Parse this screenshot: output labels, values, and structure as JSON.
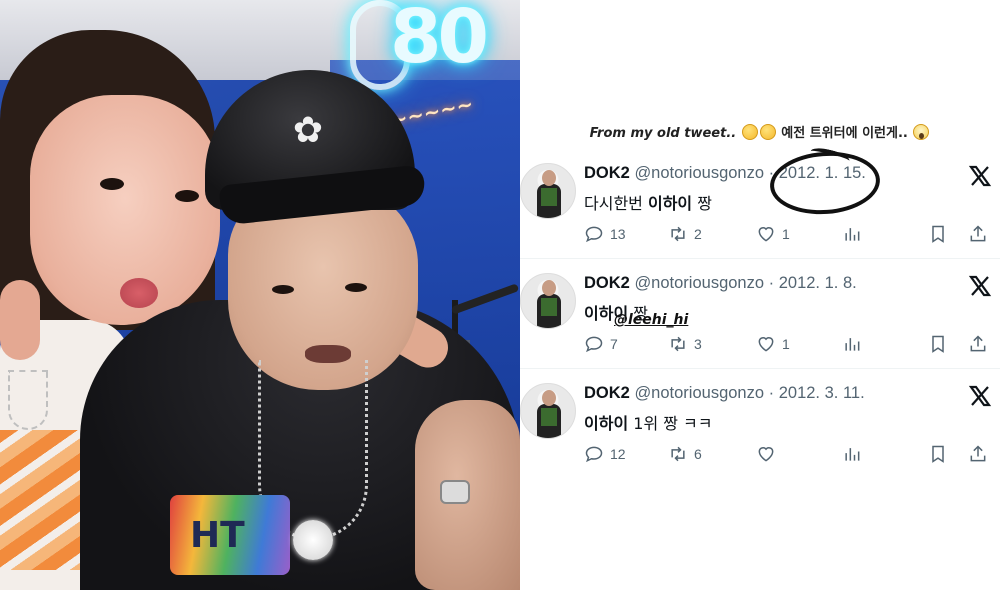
{
  "caption": {
    "english": "From my old tweet..",
    "korean": "예전 트위터에 이런게.."
  },
  "photo": {
    "neon_number": "80",
    "hoodie_print": "HT"
  },
  "tweets": [
    {
      "name": "DOK2",
      "handle": "@notoriousgonzo",
      "date": "2012. 1. 15.",
      "text_prefix": "다시한번",
      "text_bold": "이하이",
      "text_suffix": "짱",
      "replies": "13",
      "retweets": "2",
      "likes": "1"
    },
    {
      "name": "DOK2",
      "handle": "@notoriousgonzo",
      "date": "2012. 1. 8.",
      "text_prefix": "",
      "text_bold": "이하이",
      "text_suffix": "짱",
      "replies": "7",
      "retweets": "3",
      "likes": "1"
    },
    {
      "name": "DOK2",
      "handle": "@notoriousgonzo",
      "date": "2012. 3. 11.",
      "text_prefix": "",
      "text_bold": "이하이",
      "text_suffix": "1위 짱 ㅋㅋ",
      "replies": "12",
      "retweets": "6",
      "likes": ""
    }
  ],
  "annotation": {
    "mention": "@leehi_hi"
  },
  "icons": {
    "platform": "x-logo-icon",
    "reply": "reply-icon",
    "retweet": "retweet-icon",
    "like": "heart-icon",
    "views": "views-icon",
    "bookmark": "bookmark-icon",
    "share": "share-icon"
  },
  "colors": {
    "text_primary": "#0f1419",
    "text_secondary": "#536471",
    "neon": "#7ff6ff",
    "wall_blue": "#1f45a8"
  }
}
